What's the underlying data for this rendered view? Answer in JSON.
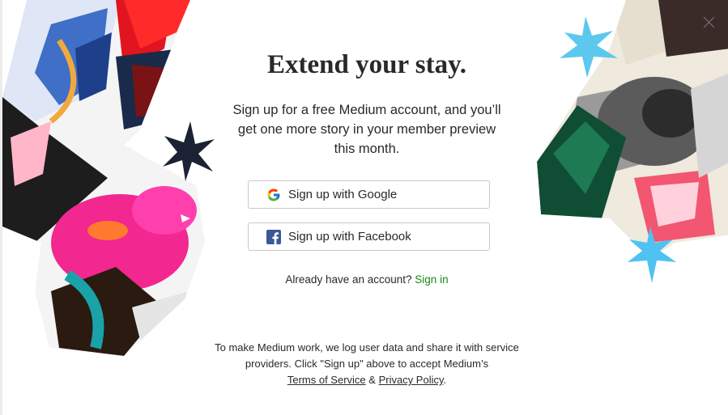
{
  "modal": {
    "title": "Extend your stay.",
    "subtitle": "Sign up for a free Medium account, and you’ll get one more story in your member preview this month.",
    "google_label": "Sign up with Google",
    "facebook_label": "Sign up with Facebook",
    "signin_prompt": "Already have an account?",
    "signin_link": "Sign in",
    "legal_text": "To make Medium work, we log user data and share it with service providers. Click \"Sign up\" above to accept Medium’s",
    "terms_link": "Terms of Service",
    "amp": "&",
    "privacy_link": "Privacy Policy",
    "period": "."
  },
  "colors": {
    "accent_green": "#1a8917",
    "facebook_blue": "#3b5998",
    "text": "#292929",
    "border": "#c9c9c9"
  },
  "icons": [
    "close-icon",
    "google-icon",
    "facebook-icon"
  ]
}
